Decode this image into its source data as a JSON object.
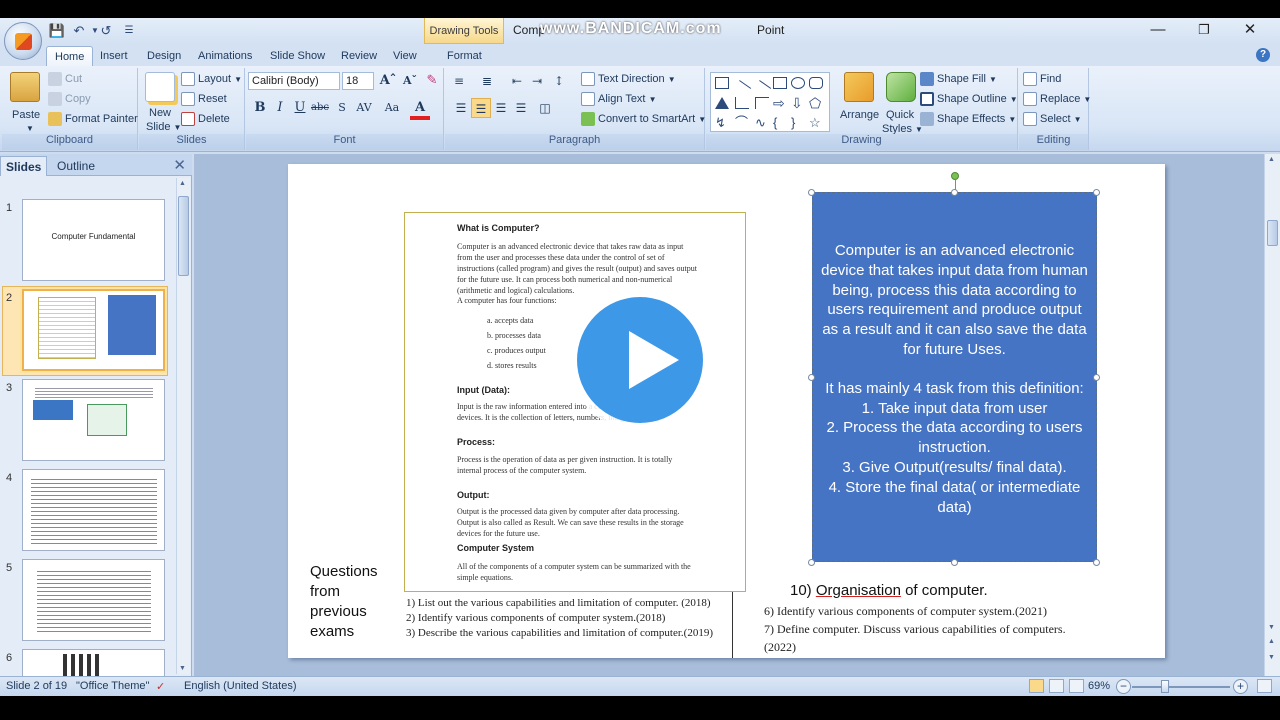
{
  "window": {
    "title": "Computer Fundamental - Microsoft PowerPoint",
    "title_visible": "Comp",
    "title_end": "Point",
    "context_tab": "Drawing Tools",
    "watermark": "www.BANDICAM.com"
  },
  "tabs": [
    "Home",
    "Insert",
    "Design",
    "Animations",
    "Slide Show",
    "Review",
    "View",
    "Format"
  ],
  "ribbon": {
    "clipboard": {
      "label": "Clipboard",
      "paste": "Paste",
      "cut": "Cut",
      "copy": "Copy",
      "format_painter": "Format Painter"
    },
    "slides": {
      "label": "Slides",
      "new_slide": "New",
      "new_slide2": "Slide",
      "layout": "Layout",
      "reset": "Reset",
      "delete": "Delete"
    },
    "font": {
      "label": "Font",
      "family": "Calibri (Body)",
      "size": "18"
    },
    "paragraph": {
      "label": "Paragraph",
      "text_direction": "Text Direction",
      "align_text": "Align Text",
      "convert_smartart": "Convert to SmartArt"
    },
    "drawing": {
      "label": "Drawing",
      "arrange": "Arrange",
      "quick_styles": "Quick",
      "quick_styles2": "Styles",
      "shape_fill": "Shape Fill",
      "shape_outline": "Shape Outline",
      "shape_effects": "Shape Effects"
    },
    "editing": {
      "label": "Editing",
      "find": "Find",
      "replace": "Replace",
      "select": "Select"
    }
  },
  "side_panel": {
    "tabs": [
      "Slides",
      "Outline"
    ],
    "slide1_title": "Computer Fundamental",
    "numbers": [
      "1",
      "2",
      "3",
      "4",
      "5",
      "6"
    ]
  },
  "slide": {
    "doc": {
      "h1": "What is Computer?",
      "p1": "Computer is an advanced electronic device that takes raw data as input from the user and processes these data under the control of set of instructions (called program) and gives the result (output) and saves output for the future use. It can process both numerical and non-numerical (arithmetic and logical) calculations.",
      "p2": "A computer has four functions:",
      "list": [
        "a. accepts data",
        "b. processes data",
        "c. produces output",
        "d. stores results"
      ],
      "h2": "Input (Data):",
      "p3": "Input is the raw information entered into a computer from the input devices. It is the collection of letters, numbers, images etc.",
      "h3": "Process:",
      "p4": "Process is the operation of data as per given instruction. It is totally internal process of the computer system.",
      "h4": "Output:",
      "p5": "Output is the processed data given by computer after data processing. Output is also called as Result. We can save these results in the storage devices for the future use.",
      "h5": "Computer System",
      "p6": "All of the components of a computer system can be summarized with the simple equations."
    },
    "box": {
      "para": "Computer is an advanced electronic device that takes input data from human being, process this data according to users requirement and produce output as a result and it can also save the data for future Uses.",
      "intro": "It has mainly 4 task from this definition:",
      "items": [
        "1.    Take input data from user",
        "2.    Process the data according to users instruction.",
        "3.    Give Output(results/ final data).",
        "4.    Store  the final data( or intermediate data)"
      ]
    },
    "questions_label": [
      "Questions",
      "from",
      "previous",
      "exams"
    ],
    "q_left": [
      "1)   List out the various capabilities and limitation of computer. (2018)",
      "2)   Identify various components of computer system.(2018)",
      "3)   Describe the various capabilities and limitation of computer.(2019)"
    ],
    "org_prefix": "10) ",
    "org_underlined": "Organisation",
    "org_suffix": " of computer.",
    "q_right": [
      "6)    Identify various components of computer system.(2021)",
      "7)    Define computer. Discuss various capabilities of computers.",
      "(2022)"
    ]
  },
  "status": {
    "slide_of": "Slide 2 of 19",
    "theme": "\"Office Theme\"",
    "language": "English (United States)",
    "zoom": "69%"
  }
}
